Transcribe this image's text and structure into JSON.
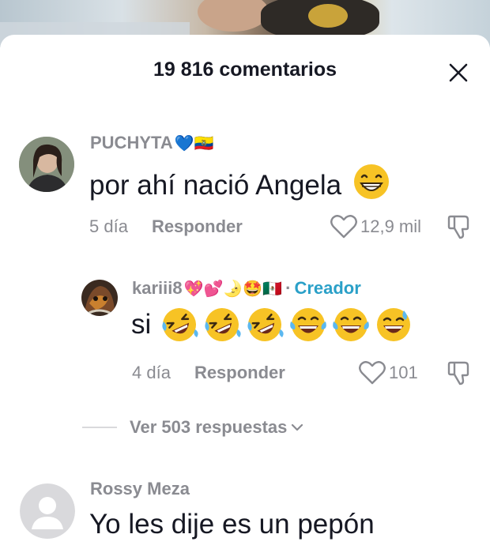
{
  "header": {
    "title": "19 816 comentarios",
    "close_icon": "close-icon"
  },
  "comments": [
    {
      "username": "PUCHYTA",
      "username_emojis": "💙🇪🇨",
      "text": "por ahí nació Angela",
      "text_emoji": "😁",
      "date": "5 día",
      "reply_label": "Responder",
      "likes": "12,9 mil"
    },
    {
      "username": "kariii8",
      "username_emojis": "💖💕🌛🤩🇲🇽",
      "creator_dot": "·",
      "creator_label": "Creador",
      "text": "si",
      "text_emojis": [
        "🤣",
        "🤣",
        "🤣",
        "😂",
        "😂",
        "😅"
      ],
      "date": "4 día",
      "reply_label": "Responder",
      "likes": "101"
    },
    {
      "username": "Rossy Meza",
      "text": "Yo les dije es un pepón"
    }
  ],
  "view_replies": {
    "label": "Ver 503 respuestas"
  },
  "colors": {
    "text_primary": "#161823",
    "text_secondary": "#8a8b91",
    "creator": "#2aa0c8",
    "emoji_yellow": "#f7c325"
  }
}
